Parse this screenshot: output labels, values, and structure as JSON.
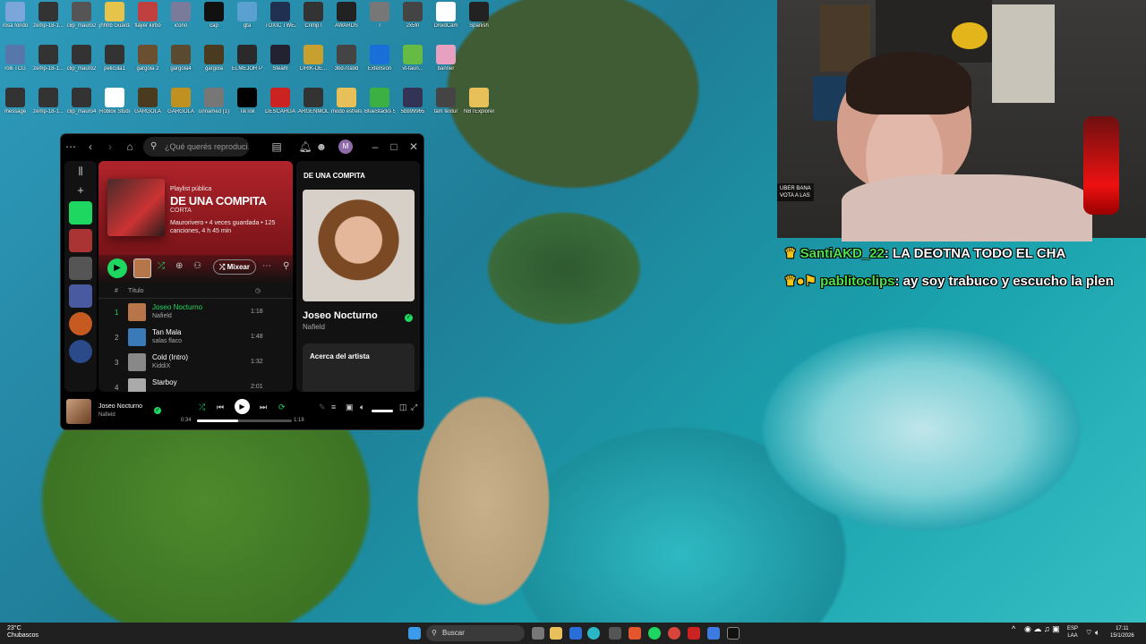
{
  "desktop_icons": [
    {
      "label": "rosa fondo",
      "color": "#7aa6d9"
    },
    {
      "label": "zemp-18-1...",
      "color": "#333"
    },
    {
      "label": "clip_mauro2",
      "color": "#555"
    },
    {
      "label": "jhhhb Guardar.",
      "color": "#e6c34a"
    },
    {
      "label": "flayer kirbo",
      "color": "#c04040"
    },
    {
      "label": "icono",
      "color": "#7a7a9a"
    },
    {
      "label": "cap",
      "color": "#111"
    },
    {
      "label": "gta",
      "color": "#5aa0d0"
    },
    {
      "label": "TOXIC TWEAKS",
      "color": "#203050"
    },
    {
      "label": "Crimp I",
      "color": "#333"
    },
    {
      "label": "AWARDS",
      "color": "#222"
    },
    {
      "label": "l",
      "color": "#777"
    },
    {
      "label": "2x5fn",
      "color": "#444"
    },
    {
      "label": "DroidCam",
      "color": "#fff"
    },
    {
      "label": "Spanish",
      "color": "#222"
    },
    {
      "label": "rolli TCG",
      "color": "#5577aa"
    },
    {
      "label": "zemp-18-1...",
      "color": "#333"
    },
    {
      "label": "clip_mauro2",
      "color": "#333"
    },
    {
      "label": "pelicula1",
      "color": "#333"
    },
    {
      "label": "gargola 2",
      "color": "#6a5030"
    },
    {
      "label": "gargola4",
      "color": "#5a4a30"
    },
    {
      "label": "gargola",
      "color": "#4a3a20"
    },
    {
      "label": "ELMEJOR PHONK",
      "color": "#2a2a2a"
    },
    {
      "label": "Steam",
      "color": "#223"
    },
    {
      "label": "LIRIK-DE...",
      "color": "#c7a030"
    },
    {
      "label": "3bd70a9d",
      "color": "#444"
    },
    {
      "label": "Extension",
      "color": "#1b6fd8"
    },
    {
      "label": "vt-taun...",
      "color": "#6b4"
    },
    {
      "label": "banner",
      "color": "#e8a0c0"
    },
    {
      "label": "message",
      "color": "#333"
    },
    {
      "label": "zemp-18-1...",
      "color": "#333"
    },
    {
      "label": "clip_mauro4",
      "color": "#333"
    },
    {
      "label": "Roblox Studio",
      "color": "#fff"
    },
    {
      "label": "GARGOLA",
      "color": "#4a3a20"
    },
    {
      "label": "GARGOLA",
      "color": "#c09020"
    },
    {
      "label": "unnamed (1)",
      "color": "#777"
    },
    {
      "label": "TikTok",
      "color": "#000"
    },
    {
      "label": "DESCARGA",
      "color": "#c22"
    },
    {
      "label": "ARGENMOD",
      "color": "#333"
    },
    {
      "label": "modo estrella",
      "color": "#e8c05a"
    },
    {
      "label": "BlueStacks 5",
      "color": "#3cb043"
    },
    {
      "label": "5bb99965",
      "color": "#335"
    },
    {
      "label": "tam textur",
      "color": "#444"
    },
    {
      "label": "NBTExplorer",
      "color": "#e8c05a"
    }
  ],
  "spotify": {
    "search_placeholder": "¿Qué querés reproduci...",
    "playlist_type": "Playlist pública",
    "playlist_name": "DE UNA COMPITA",
    "playlist_desc": "CORTA",
    "playlist_meta": "Maurorivero • 4 veces guardada • 125 canciones, 4 h 45 min",
    "shuffle_label": "Mixear",
    "col_title": "Título",
    "tracks": [
      {
        "n": "1",
        "title": "Joseo Nocturno",
        "artist": "Nafield",
        "duration": "1:18",
        "active": true,
        "color": "#b8754a"
      },
      {
        "n": "2",
        "title": "Tan Mala",
        "artist": "salas flaco",
        "duration": "1:48",
        "active": false,
        "color": "#3a7ab8"
      },
      {
        "n": "3",
        "title": "Cold (Intro)",
        "artist": "KiddiX",
        "duration": "1:32",
        "active": false,
        "color": "#888"
      },
      {
        "n": "4",
        "title": "Starboy",
        "artist": "",
        "duration": "2:01",
        "active": false,
        "color": "#aaa"
      }
    ],
    "right_header": "DE UNA COMPITA",
    "right_title": "Joseo Nocturno",
    "right_artist": "Nafield",
    "about_artist": "Acerca del artista",
    "now_title": "Joseo Nocturno",
    "now_artist": "Nafield",
    "time_elapsed": "0:34",
    "time_total": "1:18",
    "progress": 0.43
  },
  "webcam": {
    "overlay_line1": "UBER BANA",
    "overlay_line2": "VOTA A LAS"
  },
  "chat": [
    {
      "user": "SantiAKD_22",
      "message": "LA DEOTNA TODO EL CHA"
    },
    {
      "user": "pablitoclips",
      "message": "ay soy trabuco y escucho la plen"
    }
  ],
  "taskbar": {
    "weather_temp": "23°C",
    "weather_desc": "Chubascos",
    "search_label": "Buscar",
    "lang1": "ESP",
    "lang2": "LAA",
    "time": "17:11",
    "date": "15/1/2026"
  }
}
